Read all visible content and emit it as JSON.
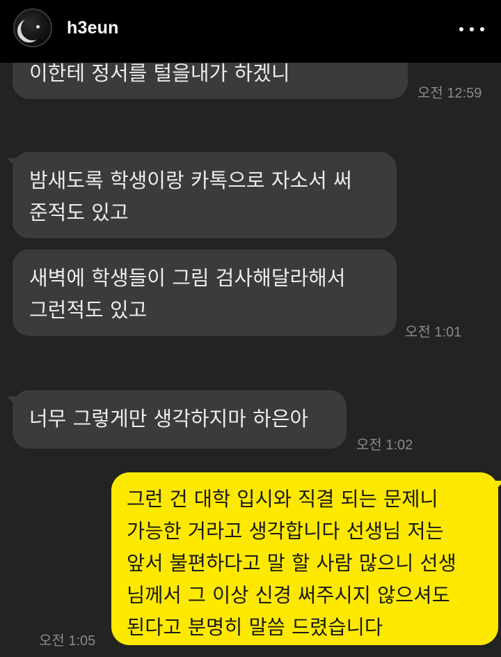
{
  "header": {
    "username": "h3eun"
  },
  "messages": [
    {
      "lines": [
        "이한테 정서를 털을내가 하겠니"
      ],
      "time": "오전 12:59"
    },
    {
      "lines": [
        "밤새도록 학생이랑 카톡으로 자소서 써",
        "준적도 있고"
      ]
    },
    {
      "lines": [
        "새벽에 학생들이 그림 검사해달라해서",
        "그런적도 있고"
      ],
      "time": "오전 1:01"
    },
    {
      "lines": [
        "너무 그렇게만 생각하지마 하은아"
      ],
      "time": "오전 1:02"
    },
    {
      "lines": [
        "그런 건 대학 입시와 직결 되는 문제니",
        "가능한 거라고 생각합니다 선생님 저는",
        "앞서 불편하다고 말 할 사람 많으니 선생",
        "님께서 그 이상 신경 써주시지 않으셔도",
        "된다고 분명히 말씀 드렸습니다"
      ],
      "time": "오전 1:05"
    }
  ]
}
